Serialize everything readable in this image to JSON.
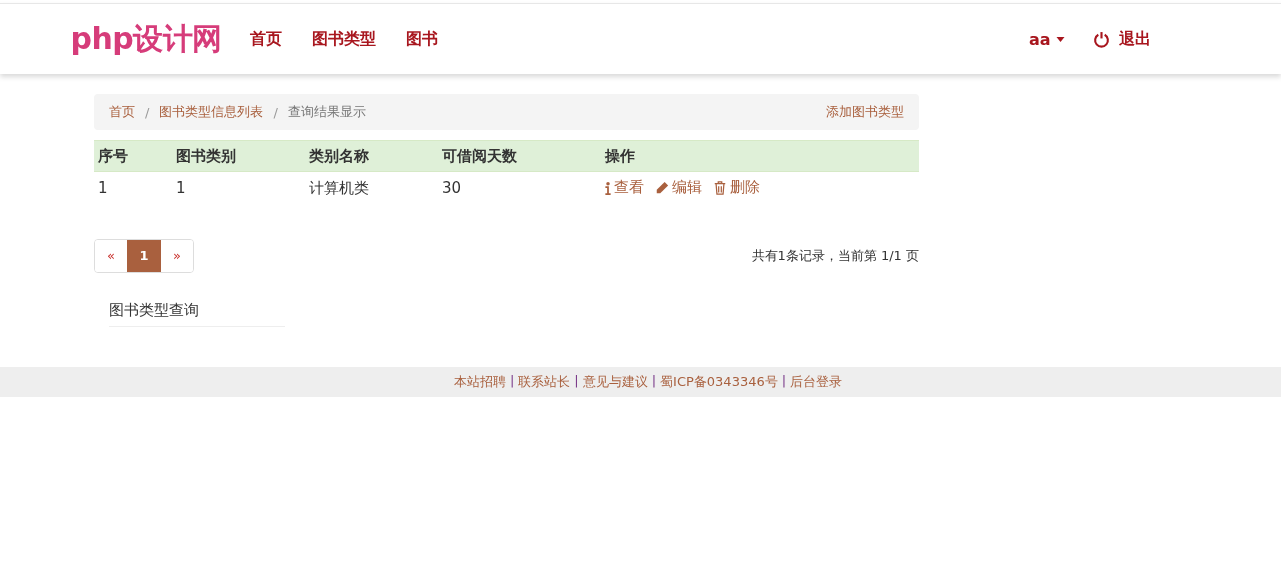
{
  "navbar": {
    "brand": "php设计网",
    "items": [
      {
        "label": "首页"
      },
      {
        "label": "图书类型"
      },
      {
        "label": "图书"
      }
    ],
    "user": "aa",
    "logout": "退出"
  },
  "breadcrumb": {
    "separator": "/",
    "items": [
      {
        "label": "首页",
        "kind": "link"
      },
      {
        "label": "图书类型信息列表",
        "kind": "link"
      },
      {
        "label": "查询结果显示",
        "kind": "current"
      }
    ],
    "action": "添加图书类型"
  },
  "table": {
    "columns": [
      "序号",
      "图书类别",
      "类别名称",
      "可借阅天数",
      "操作"
    ],
    "rows": [
      {
        "cells": [
          "1",
          "1",
          "计算机类",
          "30"
        ],
        "actions": [
          {
            "kind": "view",
            "label": "查看"
          },
          {
            "kind": "edit",
            "label": "编辑"
          },
          {
            "kind": "delete",
            "label": "删除"
          }
        ]
      }
    ]
  },
  "pagination": {
    "items": [
      {
        "label": "«",
        "selected": false
      },
      {
        "label": "1",
        "selected": true
      },
      {
        "label": "»",
        "selected": false
      }
    ],
    "summary": "共有1条记录，当前第 1/1 页"
  },
  "side_panel": {
    "title": "图书类型查询"
  },
  "footer": {
    "items": [
      {
        "kind": "link",
        "text": "本站招聘"
      },
      {
        "kind": "sep",
        "text": "|"
      },
      {
        "kind": "link",
        "text": "联系站长"
      },
      {
        "kind": "sep",
        "text": "|"
      },
      {
        "kind": "link",
        "text": "意见与建议"
      },
      {
        "kind": "sep",
        "text": "|"
      },
      {
        "kind": "link",
        "text": "蜀ICP备0343346号"
      },
      {
        "kind": "sep",
        "text": "|"
      },
      {
        "kind": "link",
        "text": "后台登录"
      }
    ]
  }
}
